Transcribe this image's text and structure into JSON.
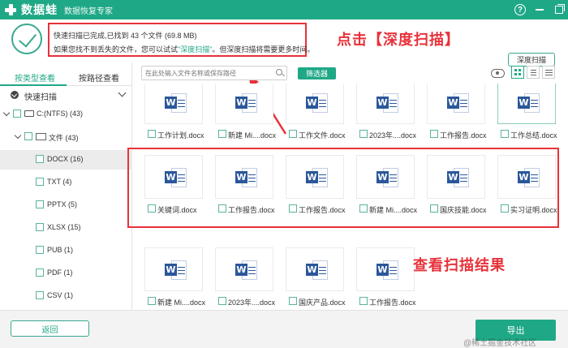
{
  "titlebar": {
    "app_name": "数据蛙",
    "subtitle": "数据恢复专家",
    "help_glyph": "?"
  },
  "status": {
    "line1": "快速扫描已完成,已找到 43 个文件 (69.8 MB)",
    "line2_prefix": "如果您找不到丢失的文件，您可以试试",
    "line2_link": "\"深度扫描\"",
    "line2_suffix": "。但深度扫描将需要更多时间。",
    "deep_scan_button": "深度扫描"
  },
  "annotations": {
    "top": "点击【深度扫描】",
    "bottom": "查看扫描结果"
  },
  "left_panel": {
    "tabs": [
      "按类型查看",
      "按路径查看"
    ],
    "active_tab": 0,
    "quick_scan_label": "快速扫描",
    "tree": [
      {
        "label": "C:(NTFS) (43)",
        "level": 0
      },
      {
        "label": "文件 (43)",
        "level": 1
      },
      {
        "label": "DOCX (16)",
        "level": 2,
        "selected": true
      },
      {
        "label": "TXT (4)",
        "level": 2
      },
      {
        "label": "PPTX (5)",
        "level": 2
      },
      {
        "label": "XLSX (15)",
        "level": 2
      },
      {
        "label": "PUB (1)",
        "level": 2
      },
      {
        "label": "PDF (1)",
        "level": 2
      },
      {
        "label": "CSV (1)",
        "level": 2
      }
    ]
  },
  "toolbar": {
    "search_placeholder": "在此处输入文件名称或保存路径",
    "filter_button": "筛选器"
  },
  "files": {
    "row1": [
      "工作计划.docx",
      "新建 Mi....docx",
      "工作文件.docx",
      "2023年....docx",
      "工作报告.docx",
      "工作总结.docx"
    ],
    "row2": [
      "关键词.docx",
      "工作报告.docx",
      "工作报告.docx",
      "新建 Mi....docx",
      "国庆技能.docx",
      "实习证明.docx"
    ],
    "row3": [
      "新建 Mi....docx",
      "2023年....docx",
      "国庆产品.docx",
      "工作报告.docx"
    ]
  },
  "bottom": {
    "back_button": "返回",
    "export_button": "导出",
    "watermark": "@稀土掘金技术社区"
  },
  "colors": {
    "brand": "#1fa886",
    "annotation_red": "#e8313a",
    "word_blue": "#2b579a"
  }
}
